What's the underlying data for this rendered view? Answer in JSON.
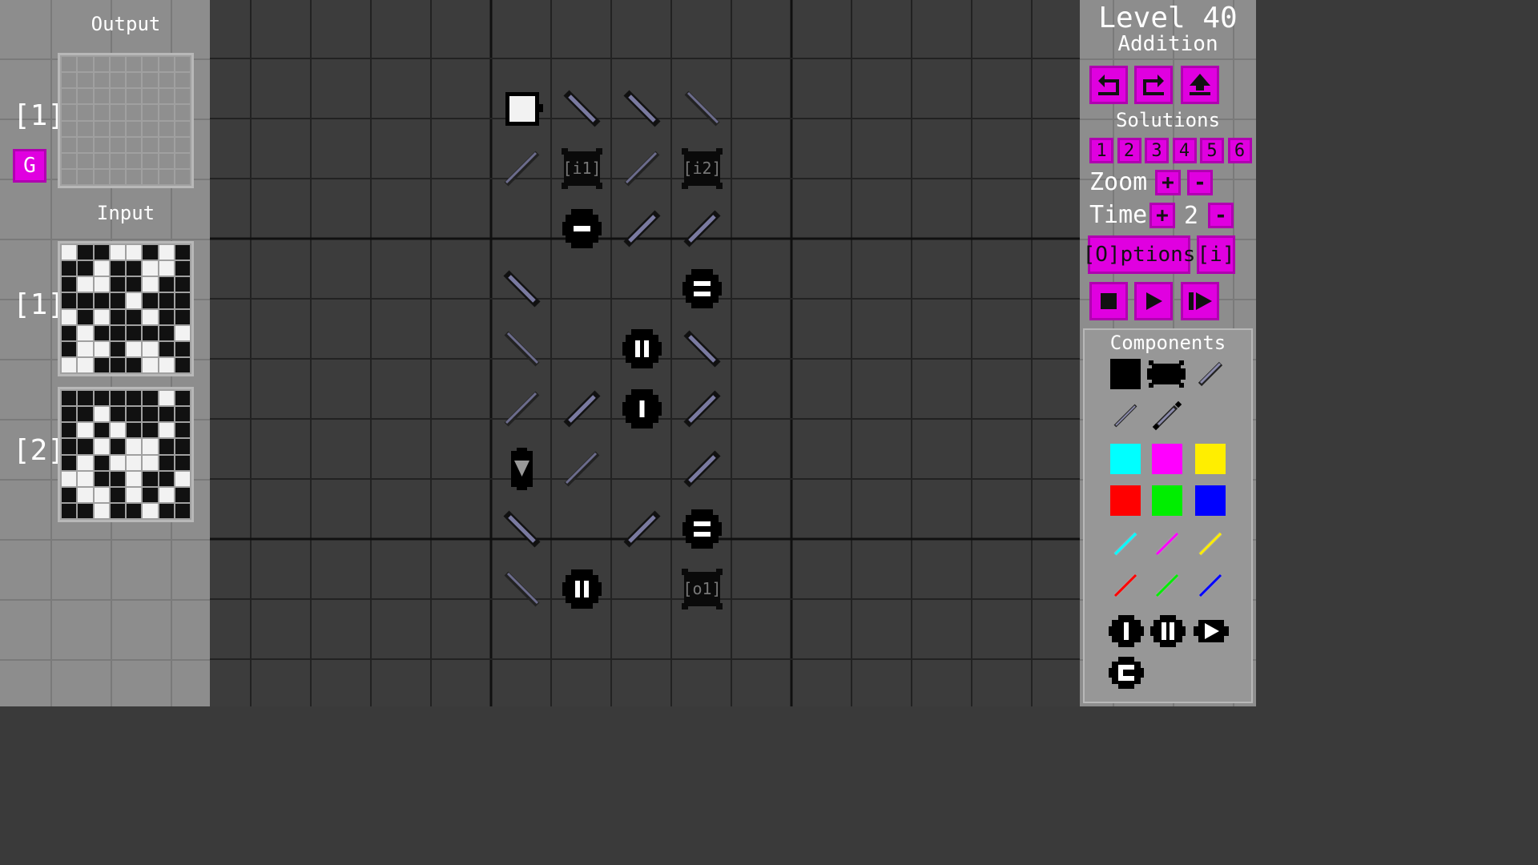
{
  "level": {
    "title": "Level 40",
    "subtitle": "Addition"
  },
  "left_panel": {
    "output_title": "Output",
    "output_index": "[1]",
    "g_button": "G",
    "input_title": "Input",
    "input_labels": [
      "[1]",
      "[2]"
    ],
    "input1": [
      "wbbwwbwb",
      "bbwbbwwb",
      "bwwbbwbb",
      "bbbbwbbb",
      "wbwbbwbb",
      "bwbbbbbw",
      "bwwbwwbb",
      "wwbbbwwb"
    ],
    "input2": [
      "bbbbbbwb",
      "bbwbbbbb",
      "bwbwbbwb",
      "bbwbwwbb",
      "bwbwwwbb",
      "wwbbwbbw",
      "bwwbwbwb",
      "bbwbbwbb"
    ]
  },
  "right_panel": {
    "toolbar_icons": [
      "undo-icon",
      "redo-icon",
      "eject-icon"
    ],
    "solutions_label": "Solutions",
    "solutions": [
      "1",
      "2",
      "3",
      "4",
      "5",
      "6"
    ],
    "zoom_label": "Zoom",
    "zoom_plus": "+",
    "zoom_minus": "-",
    "time_label": "Time",
    "time_plus": "+",
    "time_value": "2",
    "time_minus": "-",
    "options_label": "[O]ptions",
    "info_label": "[i]",
    "playback_icons": [
      "stop-icon",
      "play-icon",
      "step-icon"
    ],
    "components_title": "Components",
    "swatch_colors": [
      "#00ffff",
      "#ff00ff",
      "#ffee00",
      "#ff0000",
      "#00ee00",
      "#0000ff"
    ]
  },
  "board": {
    "cells": [
      {
        "col": 0,
        "row": 0,
        "type": "source"
      },
      {
        "col": 1,
        "row": 0,
        "type": "wire-down"
      },
      {
        "col": 2,
        "row": 0,
        "type": "wire-down"
      },
      {
        "col": 3,
        "row": 0,
        "type": "wire-down-thin"
      },
      {
        "col": 0,
        "row": 1,
        "type": "wire-up-thin"
      },
      {
        "col": 1,
        "row": 1,
        "type": "port",
        "label": "[i1]"
      },
      {
        "col": 2,
        "row": 1,
        "type": "wire-up-thin"
      },
      {
        "col": 3,
        "row": 1,
        "type": "port",
        "label": "[i2]"
      },
      {
        "col": 1,
        "row": 2,
        "type": "gate-minus"
      },
      {
        "col": 2,
        "row": 2,
        "type": "wire-up"
      },
      {
        "col": 3,
        "row": 2,
        "type": "wire-up"
      },
      {
        "col": 0,
        "row": 3,
        "type": "wire-down"
      },
      {
        "col": 3,
        "row": 3,
        "type": "gate-equals"
      },
      {
        "col": 0,
        "row": 4,
        "type": "wire-down-thin"
      },
      {
        "col": 2,
        "row": 4,
        "type": "gate-two"
      },
      {
        "col": 3,
        "row": 4,
        "type": "wire-down"
      },
      {
        "col": 0,
        "row": 5,
        "type": "wire-up-thin"
      },
      {
        "col": 1,
        "row": 5,
        "type": "wire-up"
      },
      {
        "col": 2,
        "row": 5,
        "type": "gate-one"
      },
      {
        "col": 3,
        "row": 5,
        "type": "wire-up"
      },
      {
        "col": 0,
        "row": 6,
        "type": "gate-down"
      },
      {
        "col": 1,
        "row": 6,
        "type": "wire-up-thin"
      },
      {
        "col": 3,
        "row": 6,
        "type": "wire-up"
      },
      {
        "col": 0,
        "row": 7,
        "type": "wire-down"
      },
      {
        "col": 2,
        "row": 7,
        "type": "wire-up"
      },
      {
        "col": 3,
        "row": 7,
        "type": "gate-equals"
      },
      {
        "col": 0,
        "row": 8,
        "type": "wire-down-thin"
      },
      {
        "col": 1,
        "row": 8,
        "type": "gate-two"
      },
      {
        "col": 3,
        "row": 8,
        "type": "port",
        "label": "[o1]"
      }
    ]
  }
}
